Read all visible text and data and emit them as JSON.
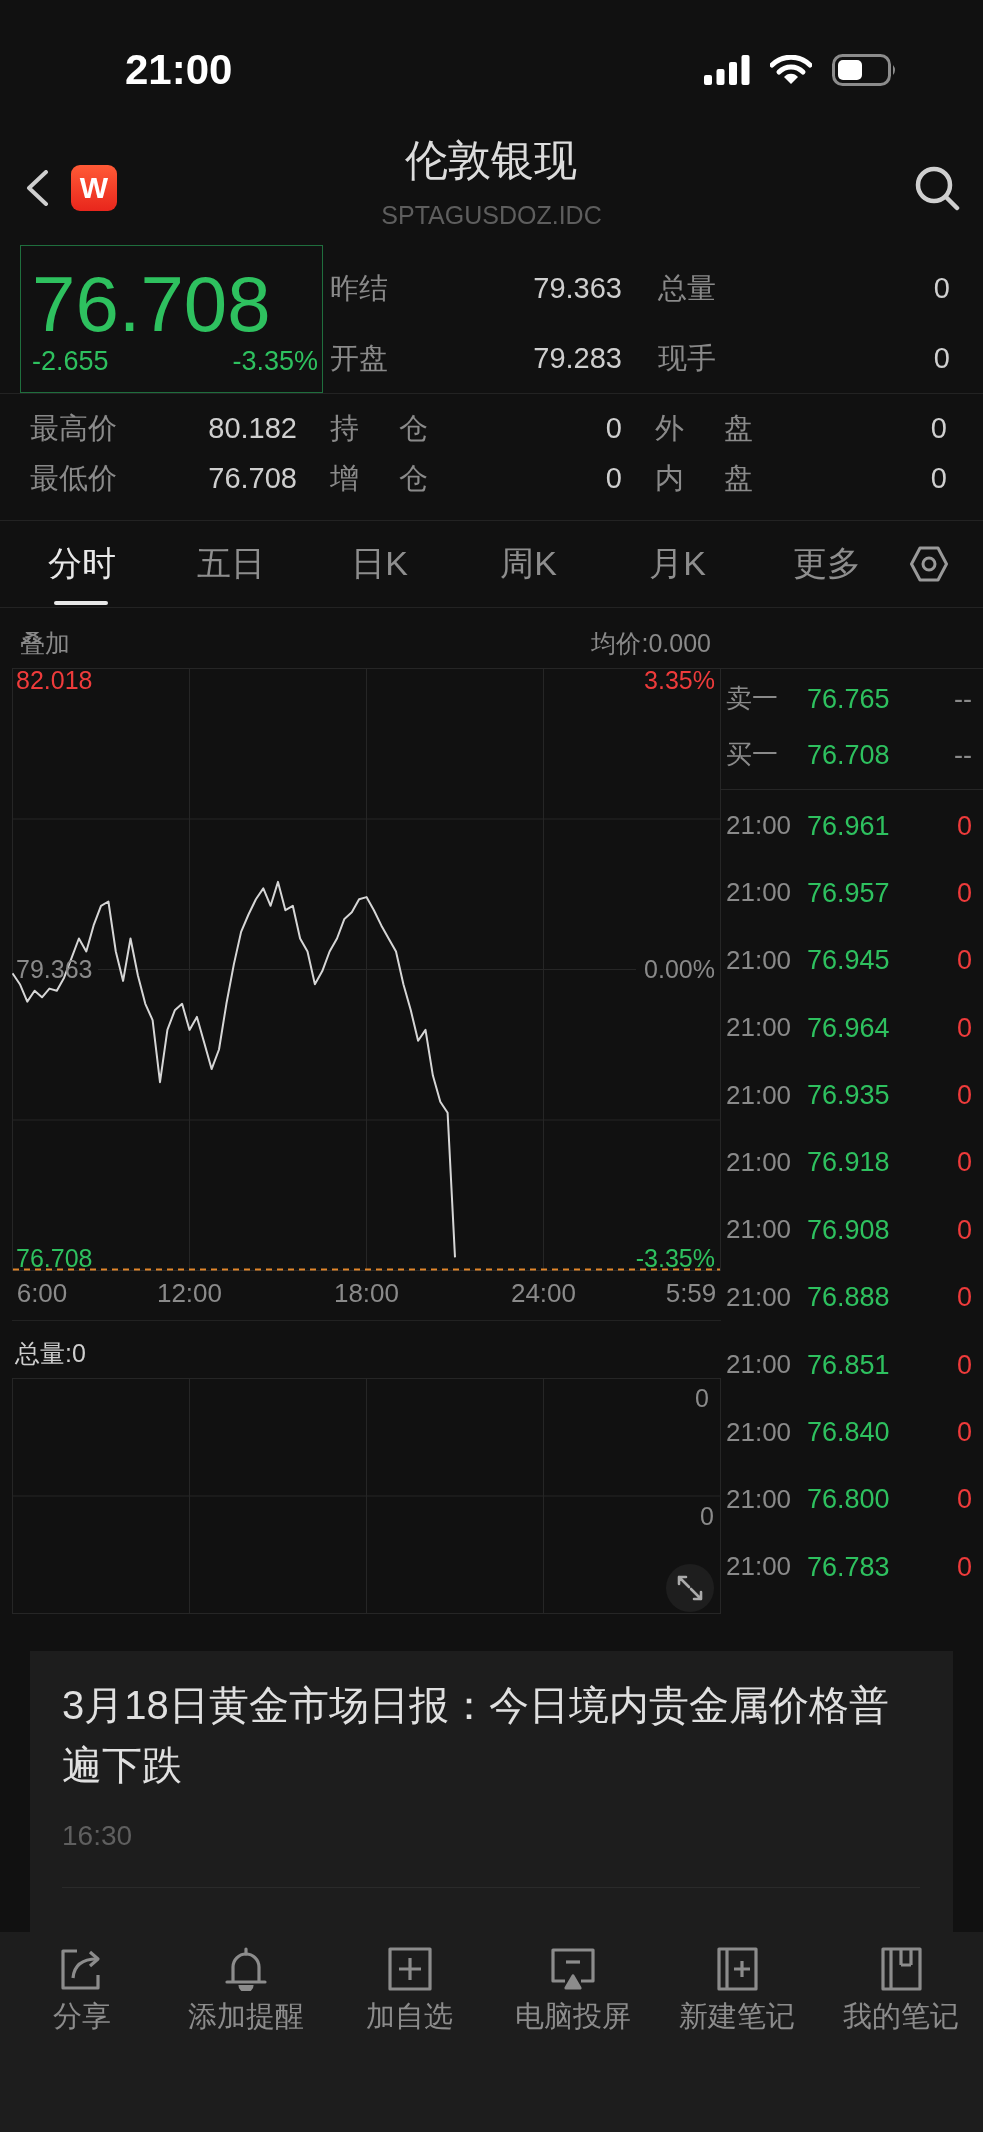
{
  "status_bar": {
    "time": "21:00"
  },
  "header": {
    "logo_letter": "W",
    "title": "伦敦银现",
    "subtitle": "SPTAGUSDOZ.IDC"
  },
  "quote": {
    "price": "76.708",
    "change": "-2.655",
    "change_percent": "-3.35%"
  },
  "stats": [
    {
      "label": "昨结",
      "value": "79.363"
    },
    {
      "label": "总量",
      "value": "0"
    },
    {
      "label": "开盘",
      "value": "79.283"
    },
    {
      "label": "现手",
      "value": "0"
    }
  ],
  "details": [
    {
      "label": "最高价",
      "value": "80.182"
    },
    {
      "label": "持 仓",
      "value": "0"
    },
    {
      "label": "外 盘",
      "value": "0"
    },
    {
      "label": "最低价",
      "value": "76.708"
    },
    {
      "label": "增 仓",
      "value": "0"
    },
    {
      "label": "内 盘",
      "value": "0"
    }
  ],
  "tabs": [
    {
      "label": "分时",
      "selected": true
    },
    {
      "label": "五日",
      "selected": false
    },
    {
      "label": "日K",
      "selected": false
    },
    {
      "label": "周K",
      "selected": false
    },
    {
      "label": "月K",
      "selected": false
    },
    {
      "label": "更多",
      "selected": false
    }
  ],
  "chart": {
    "overlay": "叠加",
    "average": "均价:0.000",
    "percent_labels": [
      "3.35%",
      "0.00%",
      "-3.35%"
    ],
    "chart_data": {
      "type": "line",
      "grid": true,
      "categories": [
        null,
        null,
        null,
        null,
        "6:00",
        null,
        null,
        null,
        null,
        null,
        null,
        null,
        null,
        null,
        null,
        null,
        null,
        null,
        null,
        null,
        null,
        null,
        null,
        null,
        "12:00",
        null,
        null,
        null,
        null,
        null,
        null,
        null,
        null,
        null,
        null,
        null,
        null,
        null,
        null,
        null,
        null,
        null,
        null,
        null,
        null,
        null,
        null,
        null,
        "18:00",
        null,
        null,
        null,
        null,
        null,
        null,
        null,
        null,
        null,
        null,
        null,
        null,
        null,
        null,
        null,
        null,
        null,
        null,
        null,
        null,
        null,
        null,
        null,
        "24:00",
        null,
        null,
        null,
        null,
        null,
        null,
        null,
        null,
        null,
        null,
        null,
        null,
        null,
        null,
        null,
        null,
        null,
        null,
        null,
        "5:59",
        null,
        null,
        null,
        null
      ],
      "values": [
        79.32,
        79.22,
        79.06,
        79.16,
        79.1,
        79.18,
        79.16,
        79.28,
        79.46,
        79.64,
        79.52,
        79.76,
        79.94,
        79.98,
        79.52,
        79.25,
        79.64,
        79.3,
        79.04,
        78.89,
        78.32,
        78.8,
        78.98,
        79.04,
        78.8,
        78.92,
        78.68,
        78.44,
        78.62,
        79.04,
        79.4,
        79.7,
        79.86,
        80,
        80.1,
        79.94,
        80.16,
        79.9,
        79.94,
        79.64,
        79.52,
        79.22,
        79.34,
        79.52,
        79.64,
        79.82,
        79.88,
        80,
        80.02,
        79.9,
        79.76,
        79.64,
        79.52,
        79.22,
        78.98,
        78.7,
        78.8,
        78.38,
        78.14,
        78.04,
        76.71,
        null,
        null,
        null,
        null,
        null,
        null,
        null,
        null,
        null,
        null,
        null,
        null,
        null,
        null,
        null,
        null,
        null,
        null,
        null,
        null,
        null,
        null,
        null,
        null,
        null,
        null,
        null,
        null,
        null,
        null,
        null,
        null,
        null,
        null,
        null,
        null
      ],
      "ylim": [
        76.59,
        82.12
      ],
      "yticks": [
        82.018,
        79.363,
        76.708
      ]
    }
  },
  "volume": {
    "total": "总量:0",
    "axis_labels": [
      "0",
      "0"
    ]
  },
  "order_book": [
    {
      "label": "卖一",
      "price": "76.765",
      "volume": "--"
    },
    {
      "label": "买一",
      "price": "76.708",
      "volume": "--"
    }
  ],
  "trades": [
    {
      "time": "21:00",
      "price": "76.961",
      "volume": "0"
    },
    {
      "time": "21:00",
      "price": "76.957",
      "volume": "0"
    },
    {
      "time": "21:00",
      "price": "76.945",
      "volume": "0"
    },
    {
      "time": "21:00",
      "price": "76.964",
      "volume": "0"
    },
    {
      "time": "21:00",
      "price": "76.935",
      "volume": "0"
    },
    {
      "time": "21:00",
      "price": "76.918",
      "volume": "0"
    },
    {
      "time": "21:00",
      "price": "76.908",
      "volume": "0"
    },
    {
      "time": "21:00",
      "price": "76.888",
      "volume": "0"
    },
    {
      "time": "21:00",
      "price": "76.851",
      "volume": "0"
    },
    {
      "time": "21:00",
      "price": "76.840",
      "volume": "0"
    },
    {
      "time": "21:00",
      "price": "76.800",
      "volume": "0"
    },
    {
      "time": "21:00",
      "price": "76.783",
      "volume": "0"
    }
  ],
  "news": [
    {
      "title": "3月18日黄金市场日报：今日境内贵金属价格普遍下跌",
      "time": "16:30"
    }
  ],
  "toolbar": [
    {
      "label": "分享",
      "kind": "share"
    },
    {
      "label": "添加提醒",
      "kind": "alert"
    },
    {
      "label": "加自选",
      "kind": "watchlist"
    },
    {
      "label": "电脑投屏",
      "kind": "cast"
    },
    {
      "label": "新建笔记",
      "kind": "new_note"
    },
    {
      "label": "我的笔记",
      "kind": "notes"
    }
  ]
}
